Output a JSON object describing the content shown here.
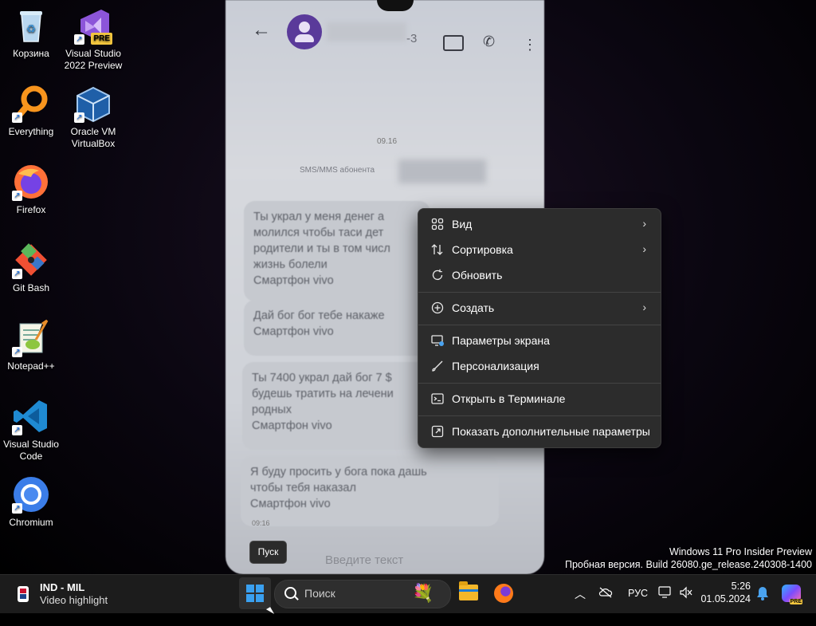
{
  "desktop": {
    "icons": [
      {
        "label": "Корзина",
        "icon": "recycle-bin-icon"
      },
      {
        "label": "Visual Studio 2022 Preview",
        "icon": "visual-studio-preview-icon",
        "badge": "PRE"
      },
      {
        "label": "Everything",
        "icon": "everything-search-icon"
      },
      {
        "label": "Oracle VM VirtualBox",
        "icon": "virtualbox-icon"
      },
      {
        "label": "Firefox",
        "icon": "firefox-icon"
      },
      {
        "label": "Git Bash",
        "icon": "git-bash-icon"
      },
      {
        "label": "Notepad++",
        "icon": "notepad-plus-plus-icon"
      },
      {
        "label": "Visual Studio Code",
        "icon": "vscode-icon"
      },
      {
        "label": "Chromium",
        "icon": "chromium-icon"
      }
    ],
    "shortcut_arrow": "↗"
  },
  "wallpaper": {
    "phone_number_fragment": "-3",
    "date_label": "09.16",
    "sms_label": "SMS/MMS абонента",
    "messages": [
      "Ты украл у меня денег а\nмолился чтобы таси дет\nродители и ты в том числ\nжизнь болели\nСмартфон vivo",
      "Дай бог бог тебе накаже\nСмартфон vivo",
      "Ты 7400 украл дай бог 7 $\nбудешь тратить на лечени\nродных\nСмартфон vivo",
      "Я буду просить у бога пока дашь\nчтобы тебя наказал\nСмартфон vivo"
    ],
    "time_label": "09:16",
    "input_placeholder": "Введите текст"
  },
  "context_menu": {
    "items": [
      {
        "label": "Вид",
        "icon": "view-grid-icon",
        "submenu": true
      },
      {
        "label": "Сортировка",
        "icon": "sort-icon",
        "submenu": true
      },
      {
        "label": "Обновить",
        "icon": "refresh-icon",
        "submenu": false
      },
      {
        "label": "Создать",
        "icon": "new-plus-icon",
        "submenu": true
      },
      {
        "label": "Параметры экрана",
        "icon": "display-settings-icon",
        "submenu": false
      },
      {
        "label": "Персонализация",
        "icon": "personalize-brush-icon",
        "submenu": false
      },
      {
        "label": "Открыть в Терминале",
        "icon": "terminal-icon",
        "submenu": false
      },
      {
        "label": "Показать дополнительные параметры",
        "icon": "more-options-icon",
        "submenu": false
      }
    ],
    "arrow_glyph": "›"
  },
  "watermark": {
    "line1": "Windows 11 Pro Insider Preview",
    "line2": "Пробная версия. Build 26080.ge_release.240308-1400"
  },
  "tooltip": {
    "label": "Пуск"
  },
  "taskbar": {
    "widget": {
      "title": "IND - MIL",
      "subtitle": "Video highlight"
    },
    "search_placeholder": "Поиск",
    "language": "РУС",
    "time": "5:26",
    "date": "01.05.2024",
    "copilot_badge": "PRE"
  }
}
